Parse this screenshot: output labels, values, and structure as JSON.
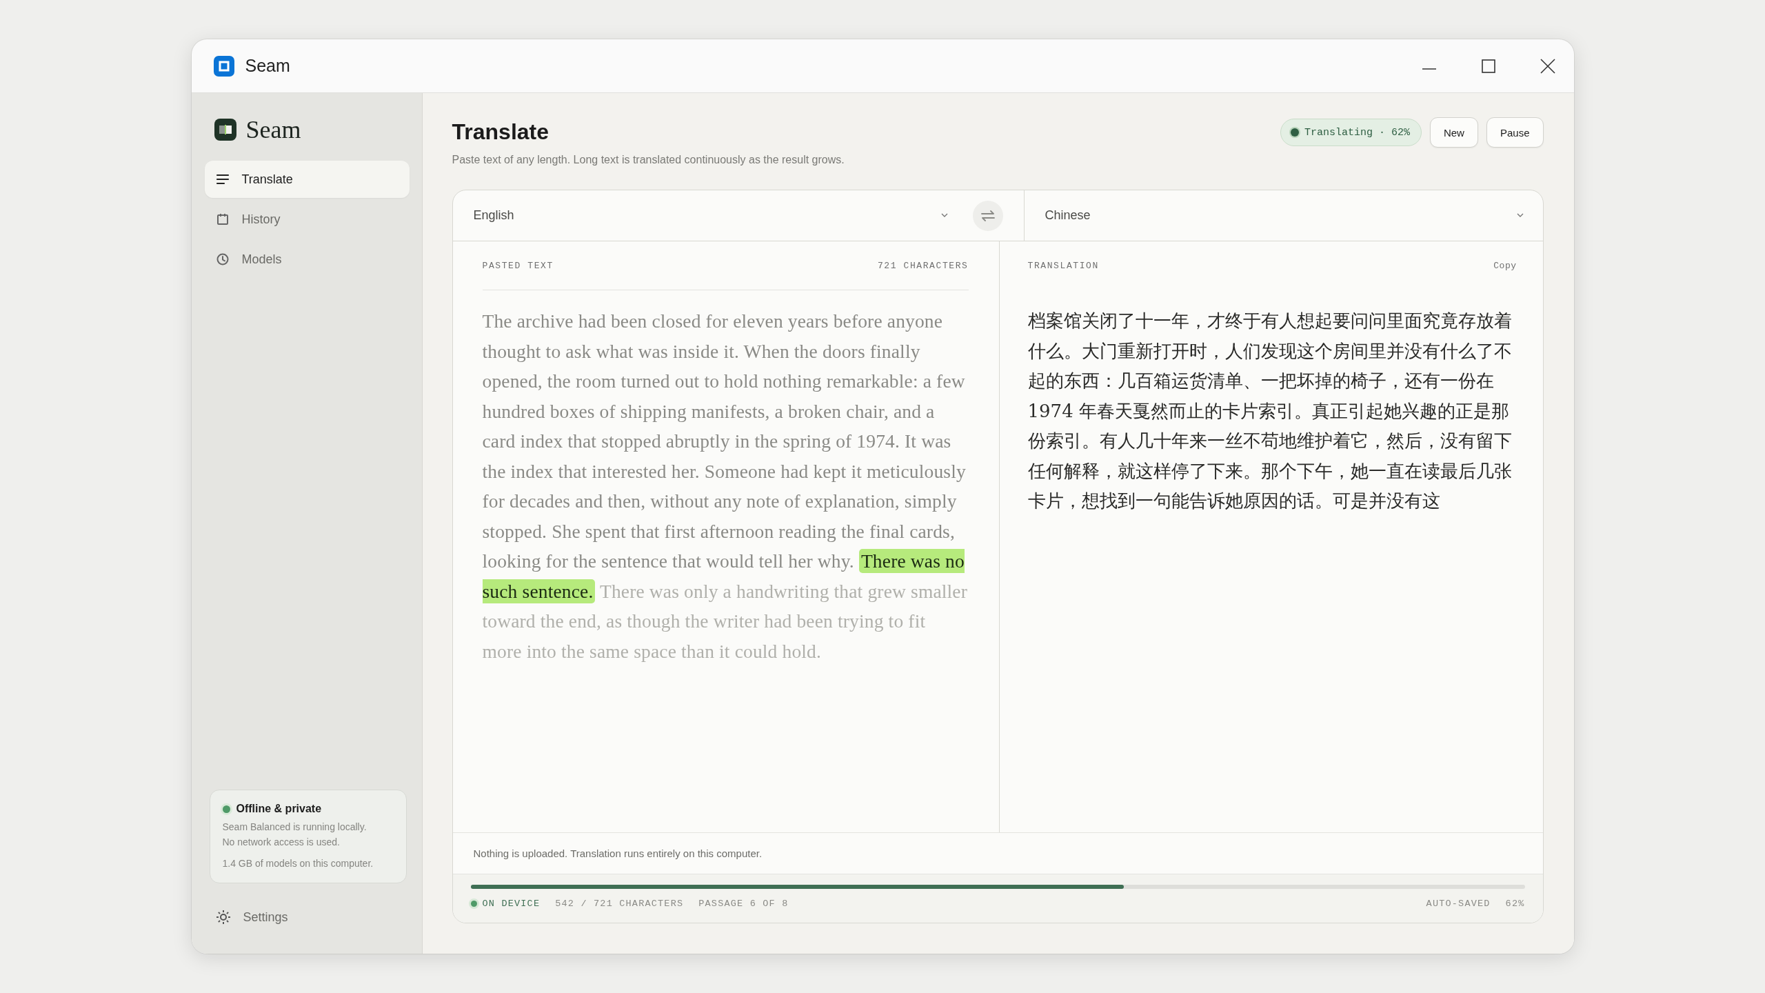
{
  "window": {
    "title": "Seam"
  },
  "sidebar": {
    "brand": "Seam",
    "items": [
      {
        "label": "Translate",
        "selected": true
      },
      {
        "label": "History",
        "selected": false
      },
      {
        "label": "Models",
        "selected": false
      }
    ],
    "status_card": {
      "title": "Offline & private",
      "lines": [
        "Seam Balanced is running locally.",
        "No network access is used."
      ],
      "footnote": "1.4 GB of models on this computer."
    },
    "settings": "Settings"
  },
  "main": {
    "title": "Translate",
    "subtitle": "Paste text of any length. Long text is translated continuously as the result grows.",
    "status": "Translating · 62%",
    "buttons": [
      "New",
      "Pause"
    ],
    "editor": {
      "source_language": "English",
      "target_language": "Chinese",
      "source": {
        "header": "PASTED TEXT",
        "count": "721 CHARACTERS",
        "segments": [
          {
            "text": "The archive had been closed for eleven years before anyone thought to ask what was inside it. When the doors finally opened, the room turned out to hold nothing remarkable: a few hundred boxes of shipping manifests, a broken chair, and a card index that stopped abruptly in the spring of 1974. It was the index that interested her. Someone had kept it meticulously for decades and then, without any note of explanation, simply stopped. She spent that first afternoon reading the final cards, looking for the sentence that would tell her why.",
            "translated": true,
            "current": false
          },
          {
            "text": "There was no such sentence.",
            "translated": true,
            "current": true
          },
          {
            "text": "There was only a handwriting that grew smaller toward the end, as though the writer had been trying to fit more into the same space than it could hold.",
            "translated": false,
            "current": false
          }
        ]
      },
      "translation": {
        "header": "TRANSLATION",
        "action": "Copy",
        "text": "档案馆关闭了十一年，才终于有人想起要问问里面究竟存放着什么。大门重新打开时，人们发现这个房间里并没有什么了不起的东西：几百箱运货清单、一把坏掉的椅子，还有一份在 1974 年春天戛然而止的卡片索引。真正引起她兴趣的正是那份索引。有人几十年来一丝不苟地维护着它，然后，没有留下任何解释，就这样停了下来。那个下午，她一直在读最后几张卡片，想找到一句能告诉她原因的话。可是并没有这"
      },
      "note": "Nothing is uploaded. Translation runs entirely on this computer.",
      "progress": {
        "level": 0.62,
        "device": "ON DEVICE",
        "count": "542 / 721 CHARACTERS",
        "passage": "PASSAGE 6 OF 8",
        "saved": "AUTO-SAVED",
        "percent": "62%"
      }
    }
  }
}
